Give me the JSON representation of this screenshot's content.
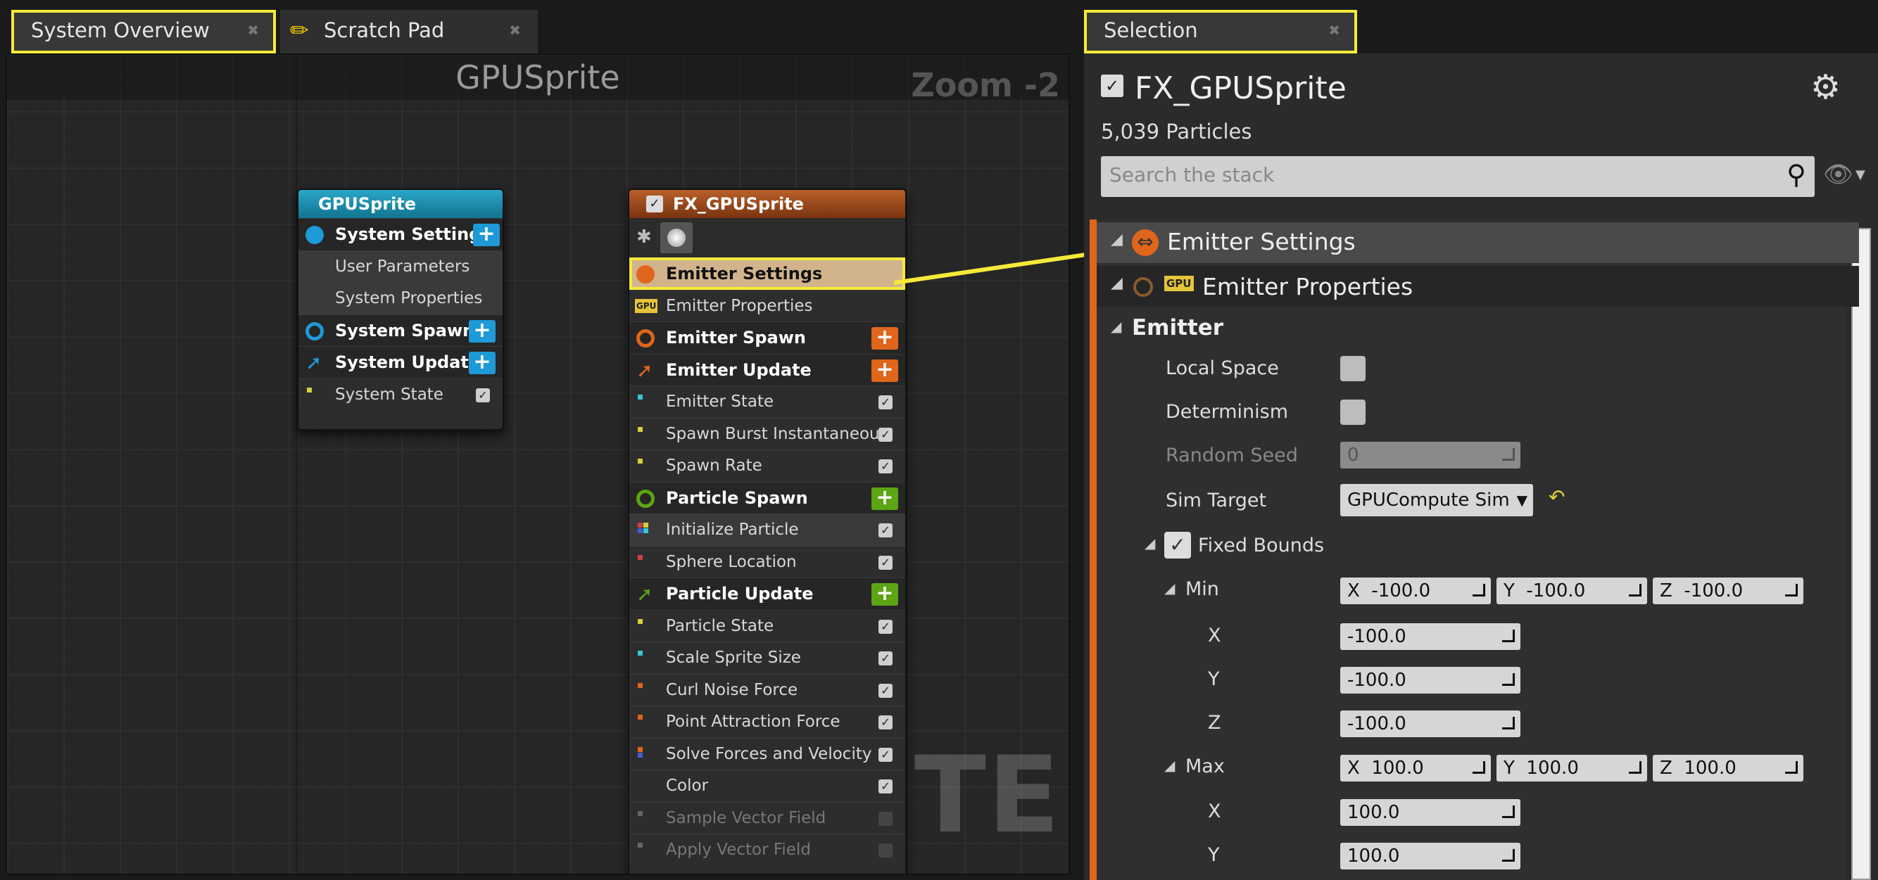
{
  "tabs": {
    "system_overview": "System Overview",
    "scratch_pad": "Scratch Pad",
    "selection": "Selection"
  },
  "graph": {
    "title": "GPUSprite",
    "zoom": "Zoom -2",
    "watermark": "SYSTEM",
    "system_node": {
      "title": "GPUSprite",
      "rows": [
        {
          "label": "System Settings",
          "kind": "section"
        },
        {
          "label": "User Parameters",
          "kind": "sub"
        },
        {
          "label": "System Properties",
          "kind": "sub"
        },
        {
          "label": "System Spawn",
          "kind": "section"
        },
        {
          "label": "System Update",
          "kind": "section"
        },
        {
          "label": "System State",
          "kind": "module"
        }
      ]
    },
    "emitter_node": {
      "title": "FX_GPUSprite",
      "gpu_badge": "GPU",
      "rows": [
        {
          "label": "Emitter Settings"
        },
        {
          "label": "Emitter Properties"
        },
        {
          "label": "Emitter Spawn"
        },
        {
          "label": "Emitter Update"
        },
        {
          "label": "Emitter State"
        },
        {
          "label": "Spawn Burst Instantaneous"
        },
        {
          "label": "Spawn Rate"
        },
        {
          "label": "Particle Spawn"
        },
        {
          "label": "Initialize Particle"
        },
        {
          "label": "Sphere Location"
        },
        {
          "label": "Particle Update"
        },
        {
          "label": "Particle State"
        },
        {
          "label": "Scale Sprite Size"
        },
        {
          "label": "Curl Noise Force"
        },
        {
          "label": "Point Attraction Force"
        },
        {
          "label": "Solve Forces and Velocity"
        },
        {
          "label": "Color"
        },
        {
          "label": "Sample Vector Field"
        },
        {
          "label": "Apply Vector Field"
        }
      ]
    }
  },
  "selection": {
    "emitter_name": "FX_GPUSprite",
    "particle_count": "5,039 Particles",
    "search_placeholder": "Search the stack",
    "emitter_settings": "Emitter Settings",
    "gpu_badge": "GPU",
    "emitter_properties": "Emitter Properties",
    "emitter_group": "Emitter",
    "local_space": "Local Space",
    "determinism": "Determinism",
    "random_seed": "Random Seed",
    "random_seed_value": "0",
    "sim_target": "Sim Target",
    "sim_target_value": "GPUCompute Sim",
    "fixed_bounds": "Fixed Bounds",
    "min": "Min",
    "max": "Max",
    "axis_x": "X",
    "axis_y": "Y",
    "axis_z": "Z",
    "min_x": "-100.0",
    "min_y": "-100.0",
    "min_z": "-100.0",
    "max_x": "100.0",
    "max_y": "100.0",
    "max_z": "100.0"
  },
  "colors": {
    "highlight": "#f5ea3a",
    "emitter_orange": "#e0661c",
    "system_blue": "#1e9ad6",
    "particle_green": "#5ca514"
  }
}
